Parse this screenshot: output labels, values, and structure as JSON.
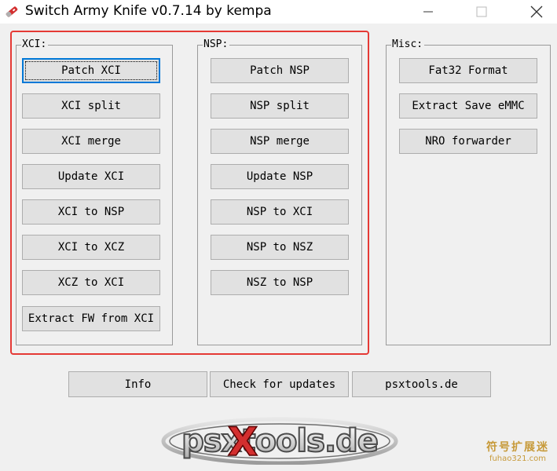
{
  "window": {
    "title": "Switch Army Knife v0.7.14 by kempa",
    "app_icon": "knife-icon",
    "controls": [
      "minimize-icon",
      "maximize-icon",
      "close-icon"
    ]
  },
  "groups": {
    "xci": {
      "label": "XCI:",
      "buttons": [
        "Patch XCI",
        "XCI split",
        "XCI merge",
        "Update XCI",
        "XCI to NSP",
        "XCI to XCZ",
        "XCZ to XCI",
        "Extract FW from XCI"
      ]
    },
    "nsp": {
      "label": "NSP:",
      "buttons": [
        "Patch NSP",
        "NSP split",
        "NSP merge",
        "Update NSP",
        "NSP to XCI",
        "NSP to NSZ",
        "NSZ to NSP"
      ]
    },
    "misc": {
      "label": "Misc:",
      "buttons": [
        "Fat32 Format",
        "Extract Save eMMC",
        "NRO forwarder"
      ]
    }
  },
  "bottom_buttons": [
    "Info",
    "Check for updates",
    "psxtools.de"
  ],
  "logo": {
    "text": "psxtools.de"
  },
  "watermark": {
    "line1": "符号扩展迷",
    "line2": "fuhao321.com"
  },
  "colors": {
    "highlight": "#e53935",
    "focus": "#0078d7",
    "watermark": "#c79a3a"
  }
}
